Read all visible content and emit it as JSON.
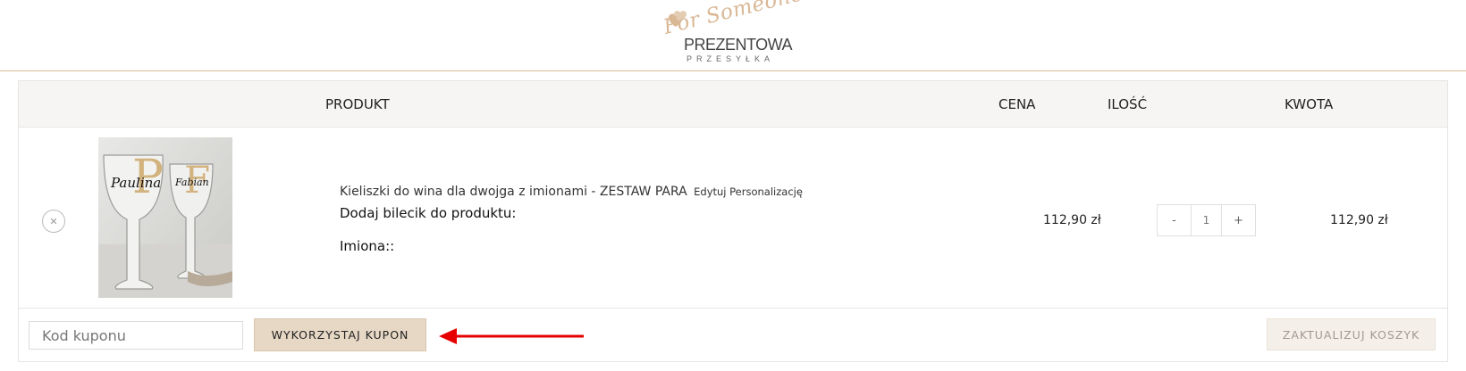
{
  "brand": {
    "script": "For Someone",
    "main": "PREZENTOWA",
    "sub": "PRZESYŁKA"
  },
  "table": {
    "headers": {
      "product": "PRODUKT",
      "price": "CENA",
      "quantity": "ILOŚĆ",
      "total": "KWOTA"
    },
    "items": [
      {
        "image_labels": [
          "Paulina",
          "Fabian"
        ],
        "name": "Kieliszki do wina dla dwojga z imionami - ZESTAW PARA",
        "edit_label": "Edytuj Personalizację",
        "add_note": "Dodaj bilecik do produktu:",
        "names_label": "Imiona::",
        "price": "112,90 zł",
        "qty_minus": "-",
        "qty_value": "1",
        "qty_plus": "+",
        "total": "112,90 zł",
        "remove_glyph": "✕"
      }
    ]
  },
  "coupon": {
    "placeholder": "Kod kuponu",
    "apply_label": "WYKORZYSTAJ KUPON"
  },
  "update_label": "ZAKTUALIZUJ KOSZYK",
  "colors": {
    "accent": "#d9b896",
    "button_bg": "#e7d8c5",
    "arrow": "#e60000"
  },
  "icons": {
    "remove": "close-icon",
    "annotation": "red-arrow-icon"
  }
}
